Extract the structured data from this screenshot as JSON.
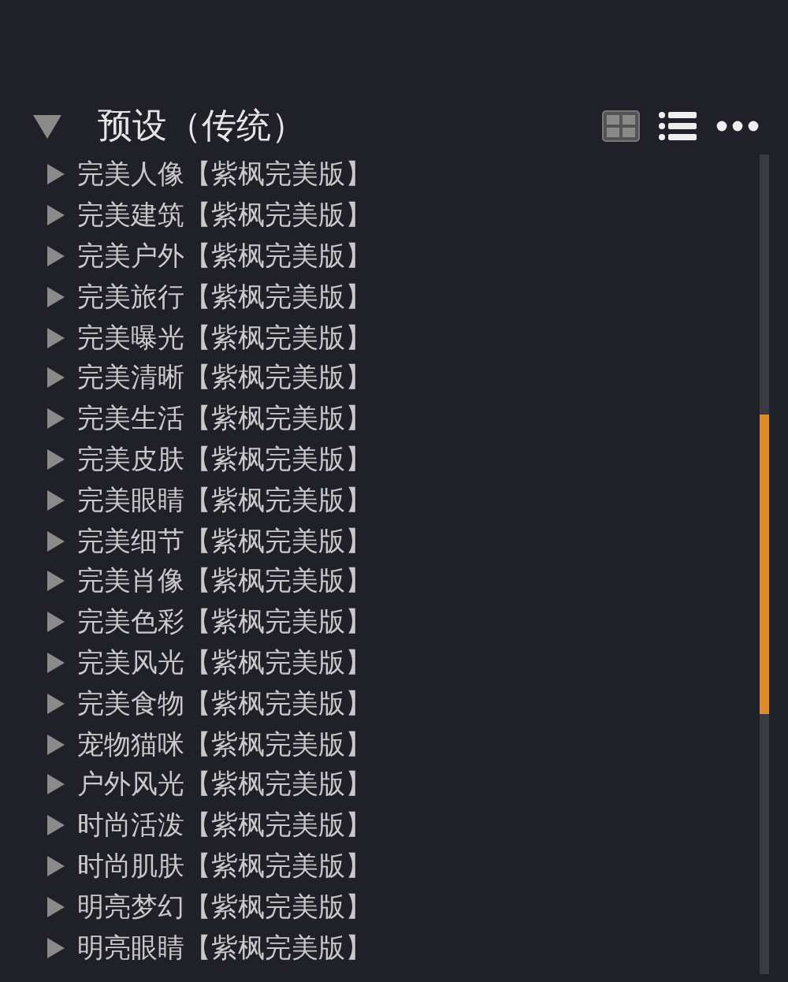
{
  "panel": {
    "title": "预设（传统）",
    "expanded": true
  },
  "presets": [
    {
      "label": "完美人像【紫枫完美版】"
    },
    {
      "label": "完美建筑【紫枫完美版】"
    },
    {
      "label": "完美户外【紫枫完美版】"
    },
    {
      "label": "完美旅行【紫枫完美版】"
    },
    {
      "label": "完美曝光【紫枫完美版】"
    },
    {
      "label": "完美清晰【紫枫完美版】"
    },
    {
      "label": "完美生活【紫枫完美版】"
    },
    {
      "label": "完美皮肤【紫枫完美版】"
    },
    {
      "label": "完美眼睛【紫枫完美版】"
    },
    {
      "label": "完美细节【紫枫完美版】"
    },
    {
      "label": "完美肖像【紫枫完美版】"
    },
    {
      "label": "完美色彩【紫枫完美版】"
    },
    {
      "label": "完美风光【紫枫完美版】"
    },
    {
      "label": "完美食物【紫枫完美版】"
    },
    {
      "label": "宠物猫咪【紫枫完美版】"
    },
    {
      "label": "户外风光【紫枫完美版】"
    },
    {
      "label": "时尚活泼【紫枫完美版】"
    },
    {
      "label": "时尚肌肤【紫枫完美版】"
    },
    {
      "label": "明亮梦幻【紫枫完美版】"
    },
    {
      "label": "明亮眼睛【紫枫完美版】"
    }
  ]
}
